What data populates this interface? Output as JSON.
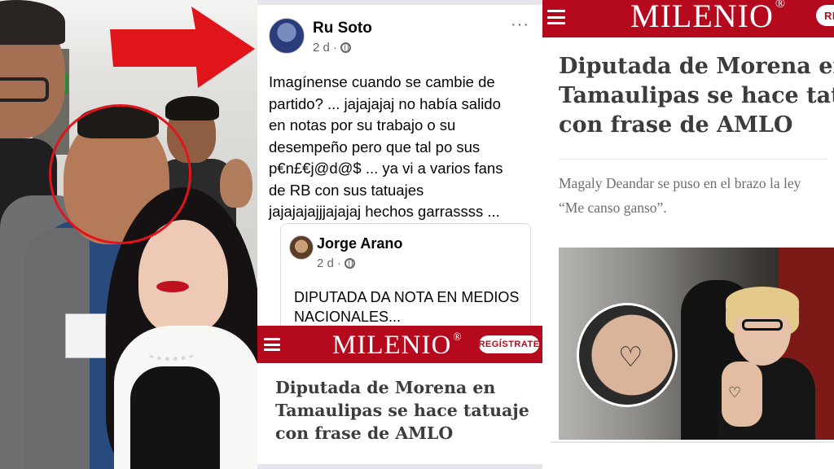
{
  "facebook_post": {
    "author": "Ru Soto",
    "time": "2 d",
    "privacy_icon": "globe-icon",
    "more_icon": "···",
    "body": "Imagínense cuando se cambie de\npartido? ... jajajajaj no había salido\nen notas por su trabajo o su\ndesempeño pero que tal po sus\np€n£€j@d@$ ... ya vi a varios fans\nde RB con sus tatuajes\njajajajajjjajajaj hechos garrassss ...",
    "shared": {
      "author": "Jorge Arano",
      "time": "2 d",
      "body": "DIPUTADA DA NOTA EN MEDIOS\nNACIONALES..."
    }
  },
  "milenio_small": {
    "logo": "MILENIO",
    "logo_mark": "®",
    "register_label": "REGÍSTRATE",
    "headline": "Diputada de Morena en Tamaulipas se hace tatuaje con frase de AMLO"
  },
  "milenio_large": {
    "logo": "MILENIO",
    "logo_mark": "®",
    "register_label": "RE",
    "headline_lines": [
      "Diputada de Morena en",
      "Tamaulipas se hace tatuaje",
      "con frase de AMLO"
    ],
    "subline_lines": [
      "Magaly Deandar se puso en el brazo la ley",
      "“Me canso ganso”."
    ]
  },
  "colors": {
    "milenio_red": "#b5091e",
    "arrow_red": "#e0141b",
    "facebook_gray": "#65676b"
  }
}
